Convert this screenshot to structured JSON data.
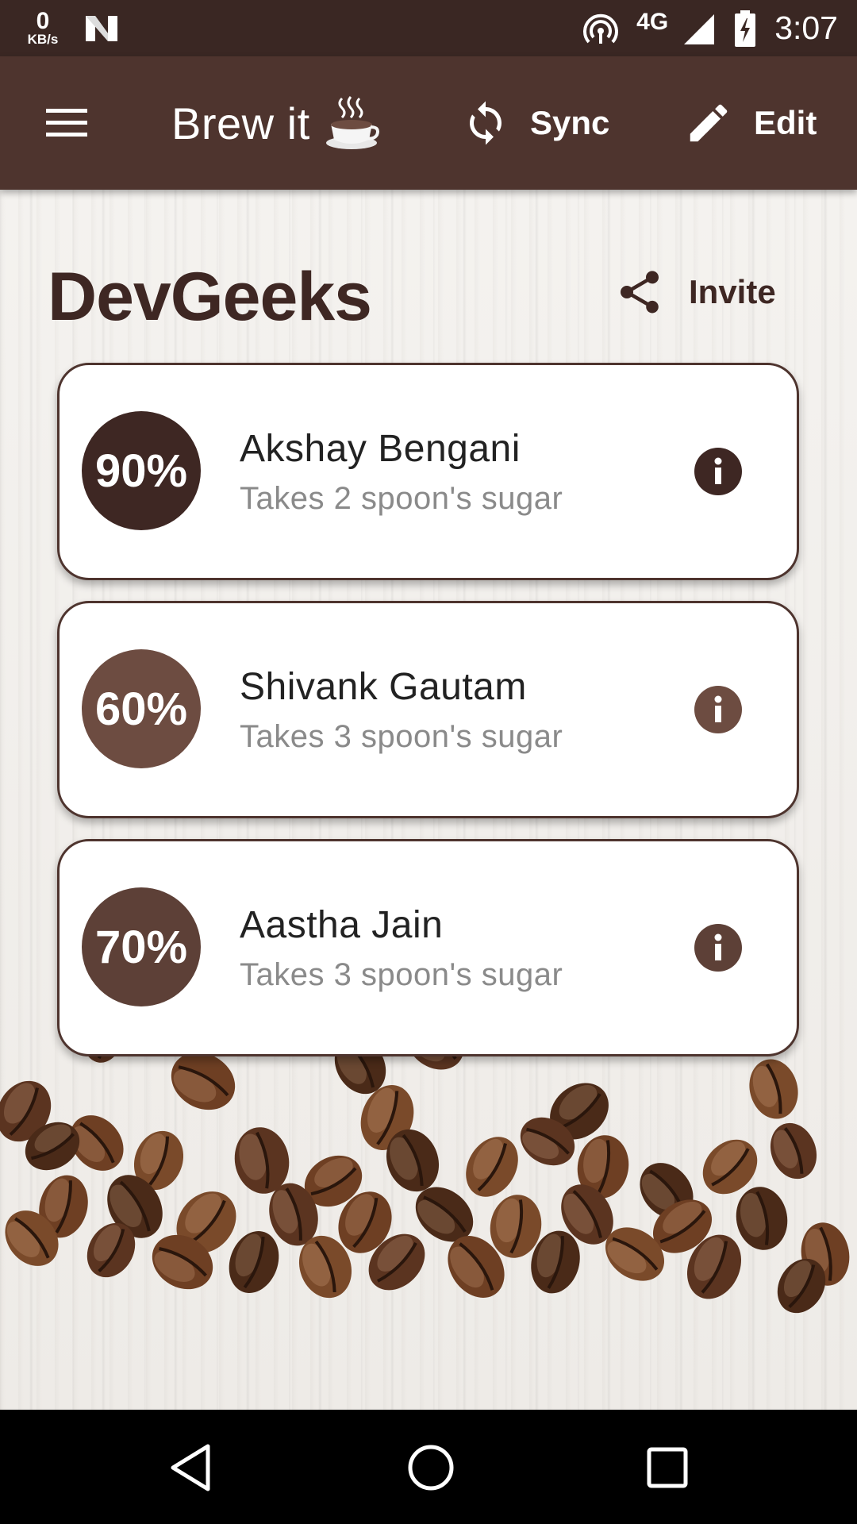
{
  "status_bar": {
    "net_speed_value": "0",
    "net_speed_unit": "KB/s",
    "network_type": "4G",
    "time": "3:07"
  },
  "app_bar": {
    "title": "Brew it",
    "sync_label": "Sync",
    "edit_label": "Edit"
  },
  "group": {
    "name": "DevGeeks",
    "invite_label": "Invite"
  },
  "members": [
    {
      "percent": "90%",
      "name": "Akshay Bengani",
      "subtitle": "Takes 2 spoon's sugar",
      "color": "#3e2723"
    },
    {
      "percent": "60%",
      "name": "Shivank Gautam",
      "subtitle": "Takes 3 spoon's sugar",
      "color": "#6d4c41"
    },
    {
      "percent": "70%",
      "name": "Aastha Jain",
      "subtitle": "Takes 3 spoon's sugar",
      "color": "#5d4037"
    }
  ],
  "colors": {
    "status_bar": "#3a2723",
    "app_bar": "#4e342e",
    "accent_dark": "#3e2723"
  },
  "icons": {
    "menu": "menu-icon",
    "cup": "coffee-cup-icon",
    "sync": "sync-icon",
    "edit": "pencil-icon",
    "invite": "share-icon",
    "info": "info-icon"
  }
}
